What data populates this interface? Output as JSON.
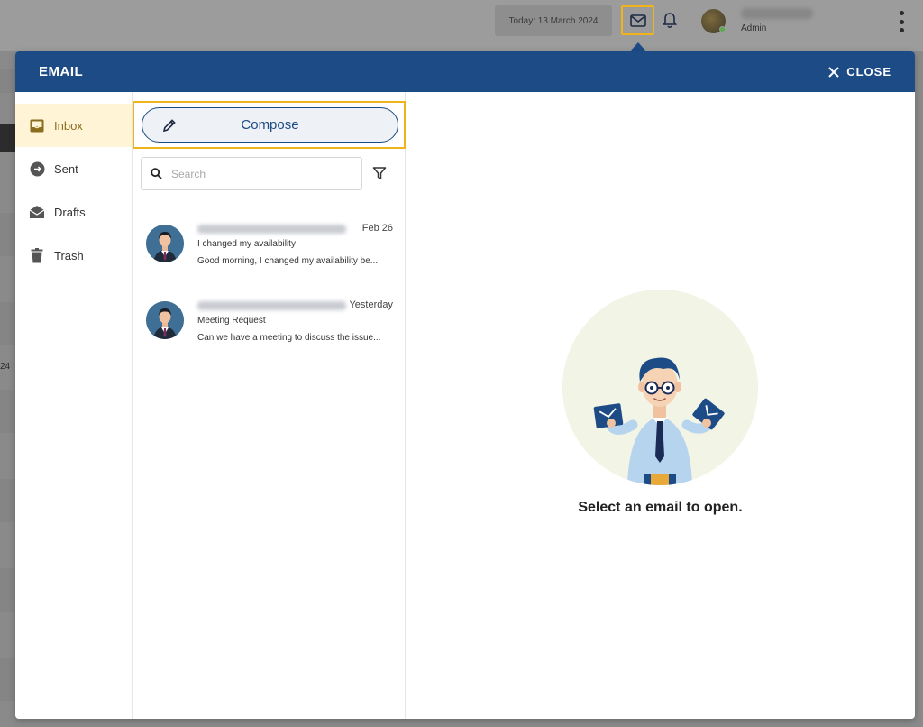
{
  "topbar": {
    "date_label": "Today: 13 March 2024",
    "user_role": "Admin"
  },
  "background": {
    "fragment_text": "24"
  },
  "modal": {
    "title": "EMAIL",
    "close_label": "CLOSE",
    "accent_color": "#1d4b86",
    "highlight_color": "#f0b31a"
  },
  "folders": [
    {
      "label": "Inbox",
      "icon": "inbox-icon",
      "active": true
    },
    {
      "label": "Sent",
      "icon": "sent-icon",
      "active": false
    },
    {
      "label": "Drafts",
      "icon": "drafts-icon",
      "active": false
    },
    {
      "label": "Trash",
      "icon": "trash-icon",
      "active": false
    }
  ],
  "compose": {
    "label": "Compose"
  },
  "search": {
    "placeholder": "Search",
    "value": ""
  },
  "emails": [
    {
      "date": "Feb 26",
      "subject": "I changed my availability",
      "preview": "Good morning, I changed my availability be..."
    },
    {
      "date": "Yesterday",
      "subject": "Meeting Request",
      "preview": "Can we have a meeting to discuss the issue..."
    }
  ],
  "reader": {
    "empty_message": "Select an email to open."
  }
}
